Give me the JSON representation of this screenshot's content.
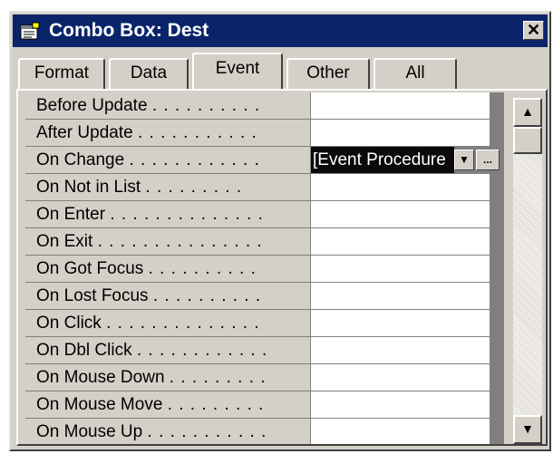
{
  "window": {
    "title": "Combo Box: Dest",
    "close_glyph": "✕",
    "icon": "properties-sheet-icon"
  },
  "tabs": [
    {
      "label": "Format",
      "active": false
    },
    {
      "label": "Data",
      "active": false
    },
    {
      "label": "Event",
      "active": true
    },
    {
      "label": "Other",
      "active": false
    },
    {
      "label": "All",
      "active": false
    }
  ],
  "properties": [
    {
      "label": "Before Update",
      "dots": ". . . . . . . . . .",
      "value": ""
    },
    {
      "label": "After Update",
      "dots": ". . . . . . . . . . .",
      "value": ""
    },
    {
      "label": "On Change",
      "dots": ". . . . . . . . . . . .",
      "value": "[Event Procedure",
      "selected": true
    },
    {
      "label": "On Not in List",
      "dots": ". . . . . . . . .",
      "value": ""
    },
    {
      "label": "On Enter",
      "dots": ". . . . . . . . . . . . . .",
      "value": ""
    },
    {
      "label": "On Exit",
      "dots": ". . . . . . . . . . . . . . .",
      "value": ""
    },
    {
      "label": "On Got Focus",
      "dots": ". . . . . . . . . .",
      "value": ""
    },
    {
      "label": "On Lost Focus",
      "dots": ". . . . . . . . . .",
      "value": ""
    },
    {
      "label": "On Click",
      "dots": ". . . . . . . . . . . . . .",
      "value": ""
    },
    {
      "label": "On Dbl Click",
      "dots": ". . . . . . . . . . . .",
      "value": ""
    },
    {
      "label": "On Mouse Down",
      "dots": ". . . . . . . . .",
      "value": ""
    },
    {
      "label": "On Mouse Move",
      "dots": ". . . . . . . . .",
      "value": ""
    },
    {
      "label": "On Mouse Up",
      "dots": ". . . . . . . . . . .",
      "value": ""
    }
  ],
  "selected_row_buttons": {
    "dropdown_glyph": "▼",
    "build_glyph": "..."
  },
  "scrollbar": {
    "up_glyph": "▲",
    "down_glyph": "▼"
  }
}
